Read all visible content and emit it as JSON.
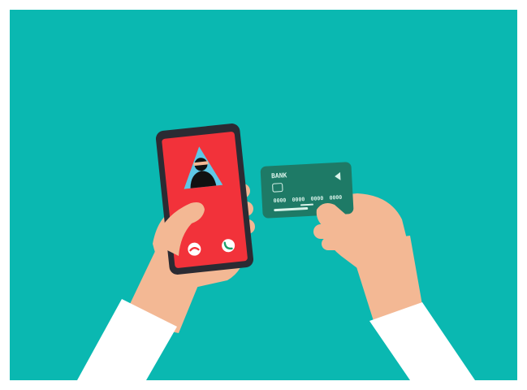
{
  "scene": {
    "background_color": "#0ab8b1",
    "frame_color": "#ffffff"
  },
  "phone": {
    "body_color": "#2b2b33",
    "screen_color": "#f2323a",
    "icons": [
      "scammer-icon",
      "decline-call-icon",
      "accept-call-icon"
    ]
  },
  "card": {
    "color": "#1e7a66",
    "bank_label": "BANK",
    "number_groups": [
      "0000",
      "0000",
      "0000",
      "0000"
    ]
  },
  "hands": {
    "skin_color": "#f3b894",
    "sleeve_color": "#ffffff"
  }
}
